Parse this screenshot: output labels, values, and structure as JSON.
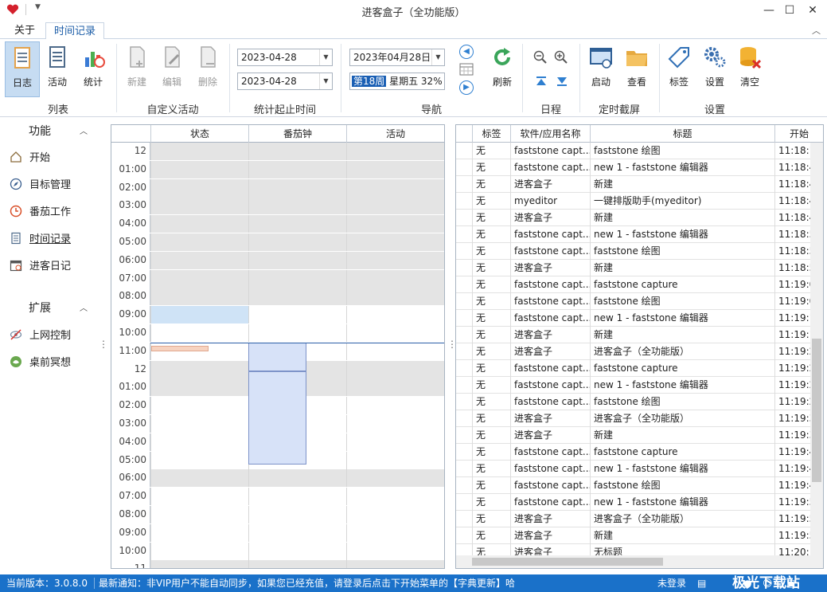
{
  "app": {
    "title": "进客盒子（全功能版）"
  },
  "tabs": [
    {
      "label": "关于"
    },
    {
      "label": "时间记录"
    }
  ],
  "ribbon": {
    "list": {
      "items": [
        "日志",
        "活动",
        "统计"
      ],
      "group": "列表"
    },
    "custom": {
      "items": [
        "新建",
        "编辑",
        "删除"
      ],
      "group": "自定义活动"
    },
    "range": {
      "start": "2023-04-28",
      "end": "2023-04-28",
      "group": "统计起止时间"
    },
    "nav": {
      "date": "2023年04月28日",
      "week_highlight": "第18周",
      "week_rest": "星期五 32%",
      "refresh": "刷新",
      "group": "导航"
    },
    "schedule": {
      "group": "日程"
    },
    "capture": {
      "items": [
        "启动",
        "查看"
      ],
      "group": "定时截屏"
    },
    "settings": {
      "items": [
        "标签",
        "设置",
        "清空"
      ],
      "group": "设置"
    }
  },
  "sidebar": {
    "func_header": "功能",
    "func_items": [
      "开始",
      "目标管理",
      "番茄工作",
      "时间记录",
      "进客日记"
    ],
    "ext_header": "扩展",
    "ext_items": [
      "上网控制",
      "桌前冥想"
    ]
  },
  "calendar": {
    "columns": [
      "状态",
      "番茄钟",
      "活动"
    ],
    "times": [
      "12",
      "01:00",
      "02:00",
      "03:00",
      "04:00",
      "05:00",
      "06:00",
      "07:00",
      "08:00",
      "09:00",
      "10:00",
      "11:00",
      "12",
      "01:00",
      "02:00",
      "03:00",
      "04:00",
      "05:00",
      "06:00",
      "07:00",
      "08:00",
      "09:00",
      "10:00",
      "11"
    ]
  },
  "grid": {
    "columns": [
      "标签",
      "软件/应用名称",
      "标题",
      "开始"
    ],
    "rows": [
      [
        "无",
        "faststone capt...",
        "faststone 绘图",
        "11:18:1"
      ],
      [
        "无",
        "faststone capt...",
        "new 1 - faststone 编辑器",
        "11:18:4"
      ],
      [
        "无",
        "进客盒子",
        "新建",
        "11:18:4"
      ],
      [
        "无",
        "myeditor",
        "一键排版助手(myeditor)",
        "11:18:4"
      ],
      [
        "无",
        "进客盒子",
        "新建",
        "11:18:4"
      ],
      [
        "无",
        "faststone capt...",
        "new 1 - faststone 编辑器",
        "11:18:5"
      ],
      [
        "无",
        "faststone capt...",
        "faststone 绘图",
        "11:18:5"
      ],
      [
        "无",
        "进客盒子",
        "新建",
        "11:18:5"
      ],
      [
        "无",
        "faststone capt...",
        "faststone capture",
        "11:19:0"
      ],
      [
        "无",
        "faststone capt...",
        "faststone 绘图",
        "11:19:0"
      ],
      [
        "无",
        "faststone capt...",
        "new 1 - faststone 编辑器",
        "11:19:1"
      ],
      [
        "无",
        "进客盒子",
        "新建",
        "11:19:1"
      ],
      [
        "无",
        "进客盒子",
        "进客盒子（全功能版）",
        "11:19:2"
      ],
      [
        "无",
        "faststone capt...",
        "faststone capture",
        "11:19:2"
      ],
      [
        "无",
        "faststone capt...",
        "new 1 - faststone 编辑器",
        "11:19:2"
      ],
      [
        "无",
        "faststone capt...",
        "faststone 绘图",
        "11:19:2"
      ],
      [
        "无",
        "进客盒子",
        "进客盒子（全功能版）",
        "11:19:3"
      ],
      [
        "无",
        "进客盒子",
        "新建",
        "11:19:3"
      ],
      [
        "无",
        "faststone capt...",
        "faststone capture",
        "11:19:4"
      ],
      [
        "无",
        "faststone capt...",
        "new 1 - faststone 编辑器",
        "11:19:4"
      ],
      [
        "无",
        "faststone capt...",
        "faststone 绘图",
        "11:19:4"
      ],
      [
        "无",
        "faststone capt...",
        "new 1 - faststone 编辑器",
        "11:19:5"
      ],
      [
        "无",
        "进客盒子",
        "进客盒子（全功能版）",
        "11:19:5"
      ],
      [
        "无",
        "进客盒子",
        "新建",
        "11:19:5"
      ],
      [
        "无",
        "进客盒子",
        "无标题",
        "11:20:"
      ]
    ]
  },
  "status": {
    "version": "当前版本：3.0.8.0",
    "notice": "最新通知：非VIP用户不能自动同步，如果您已经充值，请登录后点击下开始菜单的【字典更新】哈",
    "login": "未登录",
    "watermark": "极光下载站"
  }
}
